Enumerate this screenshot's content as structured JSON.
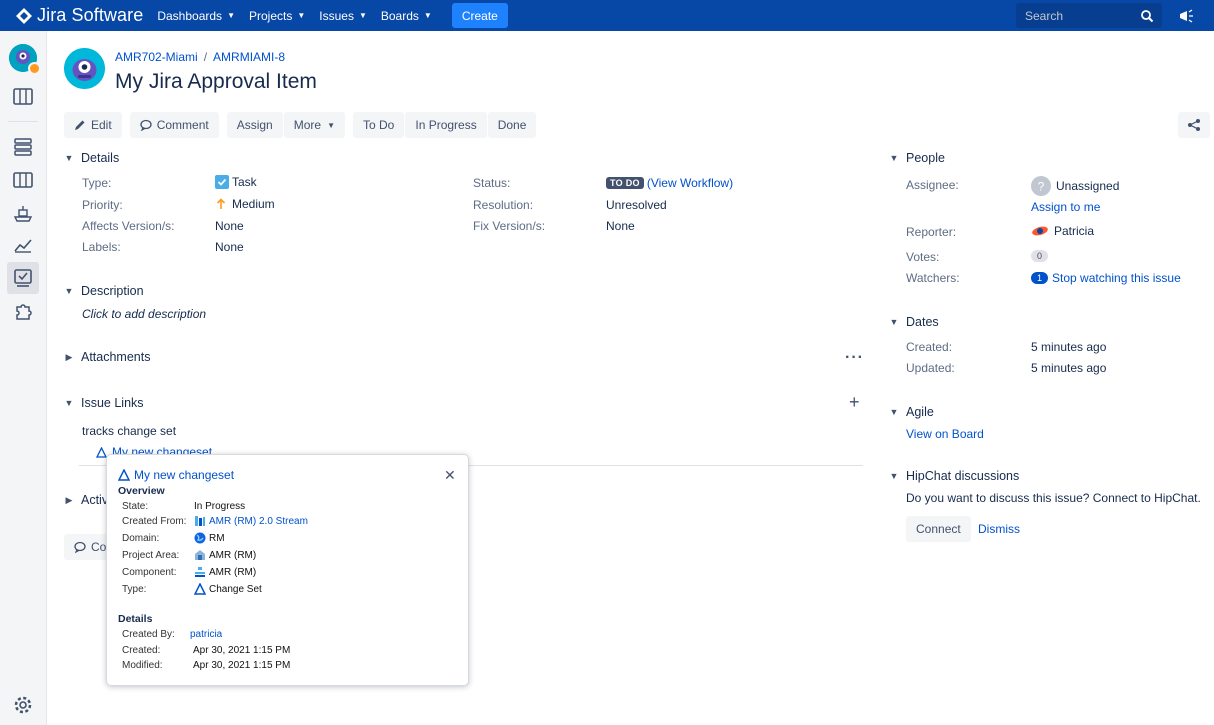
{
  "topnav": {
    "brand": "Jira Software",
    "items": [
      {
        "label": "Dashboards"
      },
      {
        "label": "Projects"
      },
      {
        "label": "Issues"
      },
      {
        "label": "Boards"
      }
    ],
    "create_label": "Create",
    "search_placeholder": "Search"
  },
  "issue": {
    "breadcrumb_project": "AMR702-Miami",
    "breadcrumb_sep": "/",
    "breadcrumb_key": "AMRMIAMI-8",
    "title": "My Jira Approval Item"
  },
  "toolbar": {
    "edit": "Edit",
    "comment": "Comment",
    "assign": "Assign",
    "more": "More",
    "todo": "To Do",
    "in_progress": "In Progress",
    "done": "Done"
  },
  "details": {
    "heading": "Details",
    "type_label": "Type:",
    "type_value": "Task",
    "priority_label": "Priority:",
    "priority_value": "Medium",
    "affects_label": "Affects Version/s:",
    "affects_value": "None",
    "labels_label": "Labels:",
    "labels_value": "None",
    "status_label": "Status:",
    "status_value": "TO DO",
    "workflow_link": "(View Workflow)",
    "resolution_label": "Resolution:",
    "resolution_value": "Unresolved",
    "fix_label": "Fix Version/s:",
    "fix_value": "None"
  },
  "description": {
    "heading": "Description",
    "placeholder": "Click to add description"
  },
  "attachments": {
    "heading": "Attachments"
  },
  "issue_links": {
    "heading": "Issue Links",
    "group_label": "tracks change set",
    "link_text": "My new changeset"
  },
  "activity": {
    "heading_partial": "Activ",
    "comment_partial": "Co"
  },
  "people": {
    "heading": "People",
    "assignee_label": "Assignee:",
    "assignee_value": "Unassigned",
    "assign_to_me": "Assign to me",
    "reporter_label": "Reporter:",
    "reporter_value": "Patricia",
    "votes_label": "Votes:",
    "votes_count": "0",
    "watchers_label": "Watchers:",
    "watchers_count": "1",
    "stop_watching": "Stop watching this issue"
  },
  "dates": {
    "heading": "Dates",
    "created_label": "Created:",
    "created_value": "5 minutes ago",
    "updated_label": "Updated:",
    "updated_value": "5 minutes ago"
  },
  "agile": {
    "heading": "Agile",
    "link": "View on Board"
  },
  "hipchat": {
    "heading": "HipChat discussions",
    "prompt": "Do you want to discuss this issue? Connect to HipChat.",
    "connect": "Connect",
    "dismiss": "Dismiss"
  },
  "popover": {
    "title": "My new changeset",
    "overview_heading": "Overview",
    "state_label": "State:",
    "state_value": "In Progress",
    "created_from_label": "Created From:",
    "created_from_value": "AMR (RM) 2.0 Stream",
    "domain_label": "Domain:",
    "domain_value": "RM",
    "project_area_label": "Project Area:",
    "project_area_value": "AMR (RM)",
    "component_label": "Component:",
    "component_value": "AMR (RM)",
    "type_label": "Type:",
    "type_value": "Change Set",
    "details_heading": "Details",
    "created_by_label": "Created By:",
    "created_by_value": "patricia",
    "created_label": "Created:",
    "created_value": "Apr 30, 2021 1:15 PM",
    "modified_label": "Modified:",
    "modified_value": "Apr 30, 2021 1:15 PM"
  },
  "colors": {
    "topbar": "#0747a6",
    "create": "#1e82ff",
    "link": "#0052cc",
    "lozenge": "#42526e"
  }
}
